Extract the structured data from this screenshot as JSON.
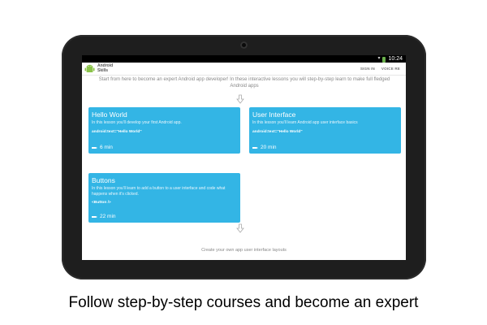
{
  "caption": "Follow step-by-step courses and become an expert",
  "status_bar": {
    "time": "10:24"
  },
  "action_bar": {
    "app_title_line1": "Android",
    "app_title_line2": "Skills",
    "menu_sign_in": "SIGN IN",
    "menu_voice": "VOICE RE"
  },
  "intro_text": "Start from here to become an expert Android app developer! In these interactive lessons you will step-by-step learn to make full fledged Android apps",
  "lessons": [
    {
      "title": "Hello World",
      "description": "In this lesson you'll develop your first Android app.",
      "code": "android:text=\"Hello World\"",
      "duration": "6 min"
    },
    {
      "title": "User Interface",
      "description": "In this lesson you'll learn Android app user interface basics",
      "code": "android:text=\"Hello World\"",
      "duration": "20 min"
    },
    {
      "title": "Buttons",
      "description": "In this lesson you'll learn to add a button to a user interface and code what happens when it's clicked.",
      "code": "<Button />",
      "duration": "22 min"
    }
  ],
  "footer_text": "Create your own app user interface layouts",
  "colors": {
    "card": "#33b5e5",
    "bezel": "#1e1e1e",
    "status_bar": "#000000",
    "logo_green": "#8bc34a"
  },
  "icons": {
    "logo": "android-logo-icon",
    "arrow": "down-arrow-icon",
    "clock": "clock-icon",
    "signal": "signal-icon",
    "battery": "battery-icon"
  }
}
